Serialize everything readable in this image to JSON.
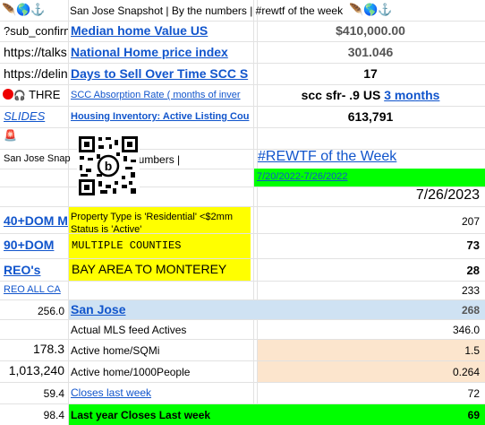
{
  "sheet": {
    "title": "San Jose Snapshot | By the numbers | #rewtf of the week",
    "title_icons": [
      "pin-icon",
      "globe-icon",
      "anchor-icon"
    ],
    "rows": [
      {
        "a": "?sub_confirm",
        "b": "Median home Value US",
        "c": "$410,000.00"
      },
      {
        "a": "https://talks",
        "b": "National Home price index",
        "c": "301.046"
      },
      {
        "a": "https://delin",
        "b": "Days to Sell Over Time SCC S",
        "c": "17"
      },
      {
        "a": "THRE",
        "b": "SCC Absorption Rate ( months of inver",
        "c_prefix": "scc sfr- .9 US",
        "c_link": "3 months"
      },
      {
        "a": "SLIDES",
        "b": "Housing Inventory: Active Listing Cou",
        "c": "613,791"
      }
    ],
    "snap_a": "San Jose Snap",
    "snap_b": "numbers |",
    "rewtf_heading": "#REWTF of the Week",
    "date_range": "7/20/2022-7/26/2022",
    "date": "7/26/2023",
    "dom40": "40+DOM M",
    "property_type": "Property Type is 'Residential' <$2mm",
    "status": "Status is 'Active'",
    "val_207": "207",
    "dom90": "90+DOM",
    "multiple_counties": "MULTIPLE COUNTIES",
    "val_73": "73",
    "reos": "REO's",
    "bay_area": "BAY AREA TO MONTEREY",
    "val_28": "28",
    "reo_all": "REO ALL CA",
    "val_233": "233",
    "sj_num": "256.0",
    "san_jose": "San Jose",
    "val_268": "268",
    "mls_label": "Actual MLS feed Actives",
    "mls_val": "346.0",
    "sqmi_num": "178.3",
    "sqmi_label": "Active home/SQMi",
    "sqmi_val": "1.5",
    "people_num": "1,013,240",
    "people_label": "Active home/1000People",
    "people_val": "0.264",
    "closes_num": "59.4",
    "closes_label": "Closes last week",
    "closes_val": "72",
    "ly_num": "98.4",
    "ly_label": "Last year Closes Last week",
    "ly_val": "69"
  },
  "colors": {
    "link": "#1155cc",
    "green": "#00ff00",
    "yellow": "#ffff00",
    "blue_row": "#cfe2f3",
    "peach": "#fce5cd"
  }
}
